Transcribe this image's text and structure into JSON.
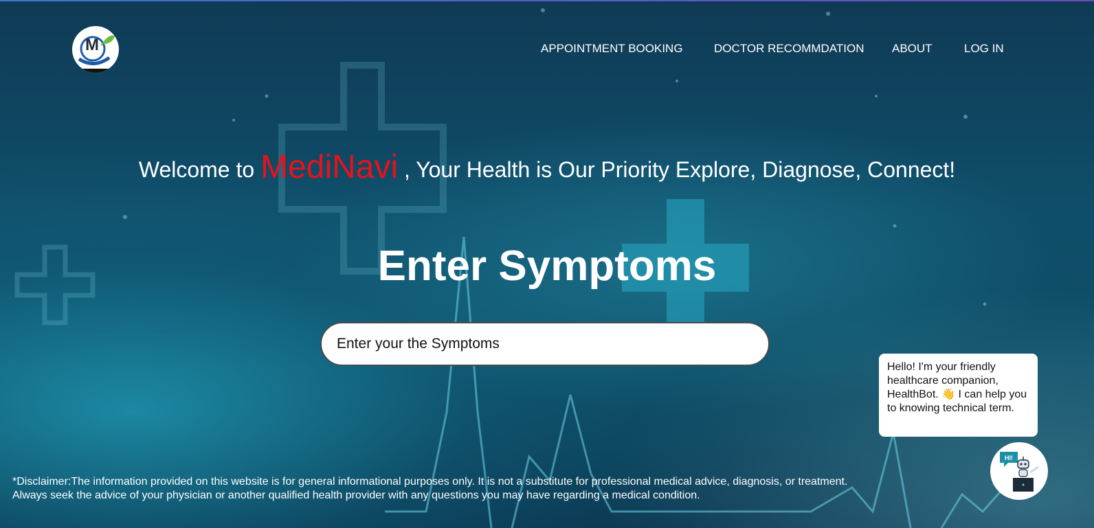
{
  "logo": {
    "letter": "M"
  },
  "nav": {
    "items": [
      {
        "label": "APPOINTMENT BOOKING"
      },
      {
        "label": "DOCTOR RECOMMDATION"
      },
      {
        "label": "ABOUT"
      },
      {
        "label": "LOG IN"
      }
    ]
  },
  "hero": {
    "welcome_prefix": "Welcome to",
    "brand": "MediNavi",
    "welcome_suffix": ", Your Health is Our Priority Explore, Diagnose, Connect!",
    "heading": "Enter Symptoms",
    "search_placeholder": "Enter your the Symptoms"
  },
  "chatbot": {
    "message": "Hello! I'm your friendly healthcare companion, HealthBot. 👋 I can help you to knowing technical term.",
    "bot_badge": "HI!"
  },
  "disclaimer": {
    "line1": "*Disclaimer:The information provided on this website is for general informational purposes only. It is not a substitute for professional medical advice, diagnosis, or treatment.",
    "line2": "Always seek the advice of your physician or another qualified health provider with any questions you may have regarding a medical condition."
  },
  "colors": {
    "brand": "#e8121c",
    "background": "#0f4e6a",
    "text": "#ffffff"
  }
}
